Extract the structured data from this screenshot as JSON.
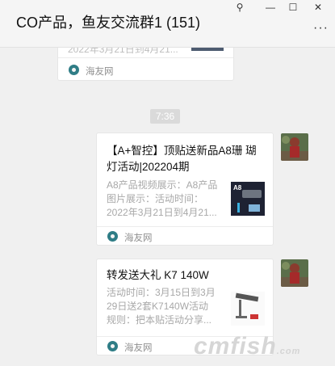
{
  "window": {
    "title": "CO产品，鱼友交流群1 (151)",
    "pin_glyph": "⚲",
    "minimize_glyph": "—",
    "maximize_glyph": "☐",
    "close_glyph": "✕",
    "more_glyph": "···"
  },
  "messages": [
    {
      "partial_desc": "2022年3月21日到4月21...",
      "source": "海友网"
    },
    {
      "time": "7:36"
    },
    {
      "title_line1": "【A+智控】顶贴送新品A8珊 瑚",
      "title_line2": "灯活动|202204期",
      "desc_line1": "A8产品视频展示：A8产品",
      "desc_line2": "图片展示：活动时间：",
      "desc_line3": "2022年3月21日到4月21...",
      "thumb_label": "A8",
      "source": "海友网"
    },
    {
      "title_line1": "转发送大礼  K7 140W",
      "desc_line1": "活动时间：3月15日到3月",
      "desc_line2": "29日送2套K7140W活动",
      "desc_line3": "规则：把本贴活动分享...",
      "source": "海友网"
    }
  ],
  "watermark": {
    "main": "cmfish",
    "suffix": ".com"
  }
}
